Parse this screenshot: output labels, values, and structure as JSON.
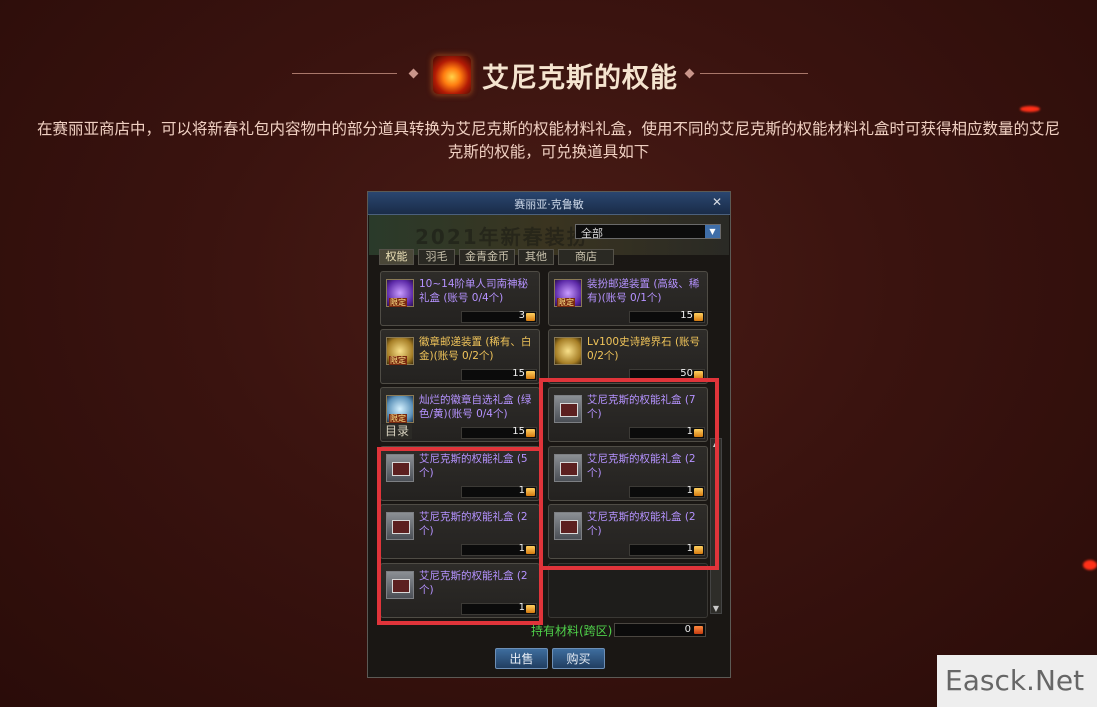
{
  "header": {
    "title": "艾尼克斯的权能",
    "title_icon": "flame-orb-icon"
  },
  "description": "在赛丽亚商店中，可以将新春礼包内容物中的部分道具转换为艾尼克斯的权能材料礼盒，使用不同的艾尼克斯的权能材料礼盒时可获得相应数量的艾尼克斯的权能，可兑换道具如下",
  "shop": {
    "window_title": "赛丽亚·克鲁敏",
    "banner_text": "2021年新春装扮",
    "dropdown_value": "全部",
    "tabs": [
      "权能",
      "羽毛",
      "金青金币",
      "其他",
      "商店"
    ],
    "catalog_label": "目录",
    "items": [
      {
        "name": "10~14阶单人司南神秘礼盒 (账号 0/4个)",
        "price": "3",
        "icon": "mystery-box-icon",
        "limited": "限定"
      },
      {
        "name": "装扮邮递装置 (高级、稀有)(账号 0/1个)",
        "price": "15",
        "icon": "costume-mail-icon",
        "limited": "限定"
      },
      {
        "name": "徽章邮递装置 (稀有、白金)(账号 0/2个)",
        "price": "15",
        "icon": "emblem-mail-icon",
        "limited": "限定"
      },
      {
        "name": "Lv100史诗跨界石 (账号 0/2个)",
        "price": "50",
        "icon": "epic-stone-icon",
        "limited": ""
      },
      {
        "name": "灿烂的徽章自选礼盒 (绿色/黄)(账号 0/4个)",
        "price": "15",
        "icon": "emblem-box-icon",
        "limited": "限定"
      },
      {
        "name": "艾尼克斯的权能礼盒 (7个)",
        "price": "1",
        "icon": "gift-box-icon",
        "limited": ""
      },
      {
        "name": "艾尼克斯的权能礼盒 (5个)",
        "price": "1",
        "icon": "gift-box-icon",
        "limited": ""
      },
      {
        "name": "艾尼克斯的权能礼盒 (2个)",
        "price": "1",
        "icon": "gift-box-icon",
        "limited": ""
      },
      {
        "name": "艾尼克斯的权能礼盒 (2个)",
        "price": "1",
        "icon": "gift-box-icon",
        "limited": ""
      },
      {
        "name": "艾尼克斯的权能礼盒 (2个)",
        "price": "1",
        "icon": "gift-box-icon",
        "limited": ""
      },
      {
        "name": "艾尼克斯的权能礼盒 (2个)",
        "price": "1",
        "icon": "gift-box-icon",
        "limited": ""
      }
    ],
    "materials_label": "持有材料(跨区)",
    "materials_value": "0",
    "sell_label": "出售",
    "buy_label": "购买"
  },
  "watermark": "Easck.Net",
  "colors": {
    "highlight": "#e0343a",
    "title": "#f5e4cf",
    "item_text": "#b592ff"
  }
}
